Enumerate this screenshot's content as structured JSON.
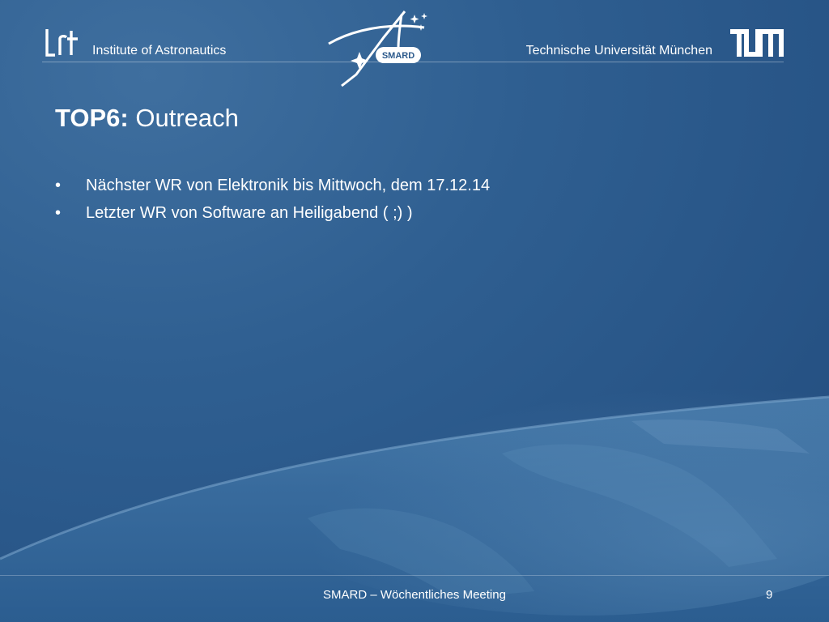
{
  "header": {
    "institute": "Institute of Astronautics",
    "university": "Technische Universität München",
    "lrt_logo": "lrt",
    "smard_logo": "SMARD",
    "tum_logo": "TUM"
  },
  "slide": {
    "title_prefix": "TOP6:",
    "title_rest": " Outreach",
    "bullet_symbol": "•",
    "bullets": [
      "Nächster WR von Elektronik bis Mittwoch, dem 17.12.14",
      "Letzter WR von Software an Heiligabend ( ;) )"
    ]
  },
  "footer": {
    "text": "SMARD – Wöchentliches Meeting",
    "page_number": "9"
  },
  "colors": {
    "background": "#2c5a8c",
    "text": "#ffffff"
  }
}
